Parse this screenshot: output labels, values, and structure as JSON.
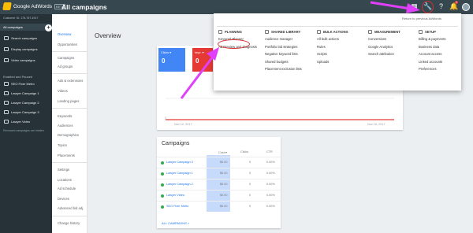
{
  "app": {
    "name": "Google AdWords",
    "badge": "BETA"
  },
  "header": {
    "title": "All campaigns"
  },
  "topbar_icons": [
    "reports-icon",
    "tools-wrench-icon",
    "help-icon",
    "notifications-icon",
    "account-avatar"
  ],
  "notifications": {
    "count": "1"
  },
  "leftnav": {
    "customer_id": "Customer ID: 178-767-4917",
    "all_campaigns": "All campaigns",
    "campaigns": [
      "Search campaigns",
      "Display campaigns",
      "Video campaigns"
    ],
    "ended_header": "Enabled and Paused",
    "ended_campaigns": [
      "SEO Fixer Metro",
      "Lawyer Campaign 1",
      "Lawyer Campaign 2",
      "Lawyer Campaign 3",
      "Lawyer Video"
    ],
    "removed_note": "Removed campaigns are hidden"
  },
  "secnav": {
    "items": [
      "Overview",
      "Opportunities",
      "Campaigns",
      "Ad groups",
      "Ads & extensions",
      "Videos",
      "Landing pages",
      "Keywords",
      "Audiences",
      "Demographics",
      "Topics",
      "Placements",
      "Settings",
      "Locations",
      "Ad schedule",
      "Devices",
      "Advanced bid adj.",
      "Change history"
    ]
  },
  "main": {
    "title": "Overview",
    "metrics": [
      {
        "label": "Clicks ▾",
        "value": "0",
        "color": "#4285f4"
      },
      {
        "label": "Impr. ▾",
        "value": "0",
        "color": "#e53935"
      }
    ],
    "chart_dates": {
      "start": "Nov 12, 2017",
      "end": "Nov 18, 2017"
    }
  },
  "campaigns_card": {
    "title": "Campaigns",
    "columns": [
      "Cost ▾",
      "Clicks",
      "CTR"
    ],
    "rows": [
      {
        "name": "Lawyer Campaign 3",
        "cost": "$0.00",
        "clicks": "0",
        "ctr": "0.00%"
      },
      {
        "name": "Lawyer Campaign 1",
        "cost": "$0.00",
        "clicks": "0",
        "ctr": "0.00%"
      },
      {
        "name": "Lawyer Campaign 2",
        "cost": "$0.00",
        "clicks": "0",
        "ctr": "0.00%"
      },
      {
        "name": "Lawyer Video",
        "cost": "$0.00",
        "clicks": "0",
        "ctr": "0.00%"
      },
      {
        "name": "SEO Fixer Metro",
        "cost": "$0.00",
        "clicks": "0",
        "ctr": "0.00%"
      }
    ],
    "all_link": "ALL CAMPAIGNS  >"
  },
  "tools_menu": {
    "return_link": "Return to previous AdWords",
    "columns": [
      {
        "heading": "PLANNING",
        "items": [
          "Keyword Planner",
          "Ad Preview and Diagnosis"
        ]
      },
      {
        "heading": "SHARED LIBRARY",
        "items": [
          "Audience manager",
          "Portfolio bid strategies",
          "Negative keyword lists",
          "Shared budgets",
          "Placement exclusion lists"
        ]
      },
      {
        "heading": "BULK ACTIONS",
        "items": [
          "All bulk actions",
          "Rules",
          "Scripts",
          "Uploads"
        ]
      },
      {
        "heading": "MEASUREMENT",
        "items": [
          "Conversions",
          "Google Analytics",
          "Search attribution"
        ]
      },
      {
        "heading": "SETUP",
        "items": [
          "Billing & payments",
          "Business data",
          "Account access",
          "Linked accounts",
          "Preferences"
        ]
      }
    ]
  },
  "colors": {
    "topbar": "#37474f",
    "nav": "#263238",
    "accent": "#1a73e8",
    "annotation": "#e040fb",
    "highlight": "#d32f2f"
  }
}
